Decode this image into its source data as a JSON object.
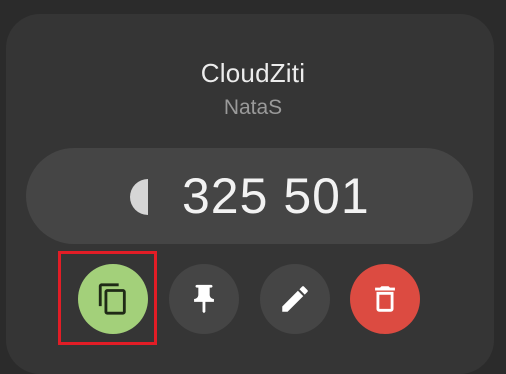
{
  "entry": {
    "issuer": "CloudZiti",
    "account": "NataS",
    "code": "325 501",
    "timer_icon": "timer-progress-icon"
  },
  "actions": [
    {
      "name": "copy",
      "icon": "copy-icon",
      "color": "#a3d07a"
    },
    {
      "name": "pin",
      "icon": "pin-icon",
      "color": "#454545"
    },
    {
      "name": "edit",
      "icon": "pencil-icon",
      "color": "#454545"
    },
    {
      "name": "delete",
      "icon": "trash-icon",
      "color": "#dc4b41"
    }
  ],
  "annotation": {
    "highlighted_action": "copy",
    "color": "#e21d26"
  },
  "colors": {
    "background": "#2b2b2b",
    "card": "#353535",
    "code_pill": "#454545"
  }
}
